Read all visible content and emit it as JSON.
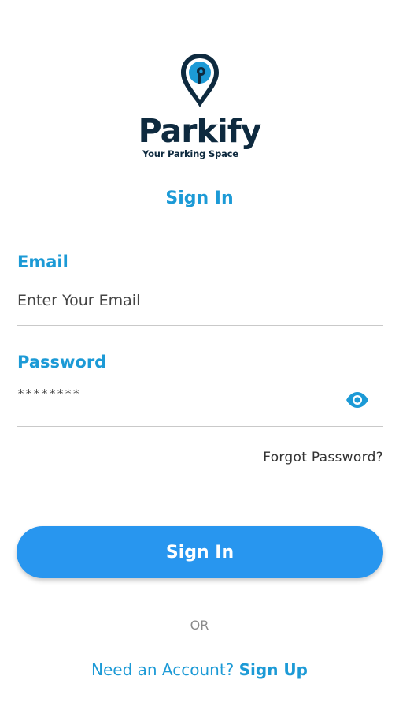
{
  "brand": {
    "name": "Parkify",
    "tagline": "Your Parking Space",
    "logo_icon": "map-pin-icon",
    "colors": {
      "primary": "#1c9ad6",
      "button": "#2896ef",
      "dark": "#0e2a3f"
    }
  },
  "page": {
    "title": "Sign In"
  },
  "form": {
    "email": {
      "label": "Email",
      "placeholder": "Enter Your Email",
      "value": ""
    },
    "password": {
      "label": "Password",
      "value": "********",
      "toggle_icon": "eye-icon"
    },
    "forgot_label": "Forgot Password?",
    "submit_label": "Sign In"
  },
  "divider": {
    "text": "OR"
  },
  "signup": {
    "prompt": "Need an Account?",
    "link": "Sign Up"
  }
}
